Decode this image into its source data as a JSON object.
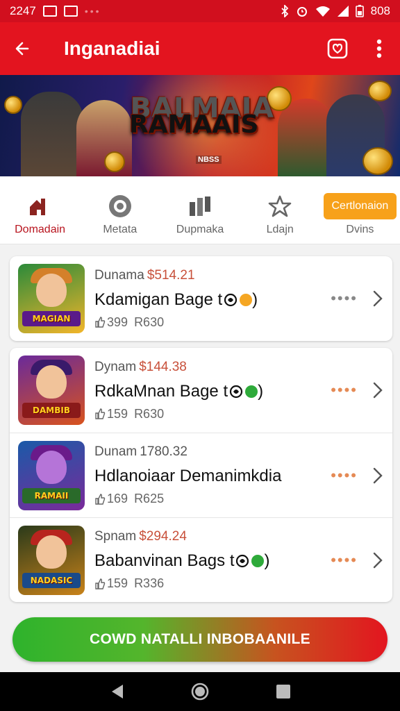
{
  "status_bar": {
    "time": "2247",
    "battery": "808",
    "icons": [
      "image-icon",
      "mail-icon",
      "bluetooth-icon",
      "alarm-icon",
      "wifi-icon",
      "signal-icon",
      "battery-icon"
    ]
  },
  "app_bar": {
    "title": "Inganadiai",
    "icons": [
      "back-arrow-icon",
      "instagram-icon",
      "more-vert-icon"
    ]
  },
  "banner": {
    "title_line1": "BALMAIA",
    "title_line2": "RAMAAIS",
    "subtitle": "NBSS"
  },
  "tabs": [
    {
      "label": "Domadain",
      "icon": "home-icon",
      "active": true
    },
    {
      "label": "Metata",
      "icon": "ring-icon",
      "active": false
    },
    {
      "label": "Dupmaka",
      "icon": "grid-icon",
      "active": false
    },
    {
      "label": "Ldajn",
      "icon": "star-icon",
      "active": false
    },
    {
      "label": "Dvins",
      "icon": "none",
      "pill_label": "Certlonaion",
      "active": false
    }
  ],
  "items": [
    {
      "line1": "Dunama",
      "price": "$514.21",
      "title": "Kdamigan Bage t",
      "badge_color": "#f5a623",
      "likes": "399",
      "code": "R630",
      "thumb_label": "MAGIAN"
    },
    {
      "line1": "Dynam",
      "price": "$144.38",
      "title": "RdkaMnan Bage t",
      "badge_color": "#2eaa3a",
      "likes": "159",
      "code": "R630",
      "thumb_label": "DAMBIB"
    },
    {
      "line1": "Dunam",
      "price": "1780.32",
      "title": "Hdlanoiaar Demanimkdia",
      "badge_color": "",
      "likes": "169",
      "code": "R625",
      "thumb_label": "RAMAII"
    },
    {
      "line1": "Spnam",
      "price": "$294.24",
      "title": "Babanvinan Bags t",
      "badge_color": "#2eaa3a",
      "likes": "159",
      "code": "R336",
      "thumb_label": "NADASIC"
    }
  ],
  "cta": {
    "label": "COWD NATALLI INBOBAANILE"
  },
  "colors": {
    "primary": "#e3141f",
    "accent": "#f7a11a",
    "cta_start": "#2eb32c",
    "cta_end": "#e3151f"
  }
}
